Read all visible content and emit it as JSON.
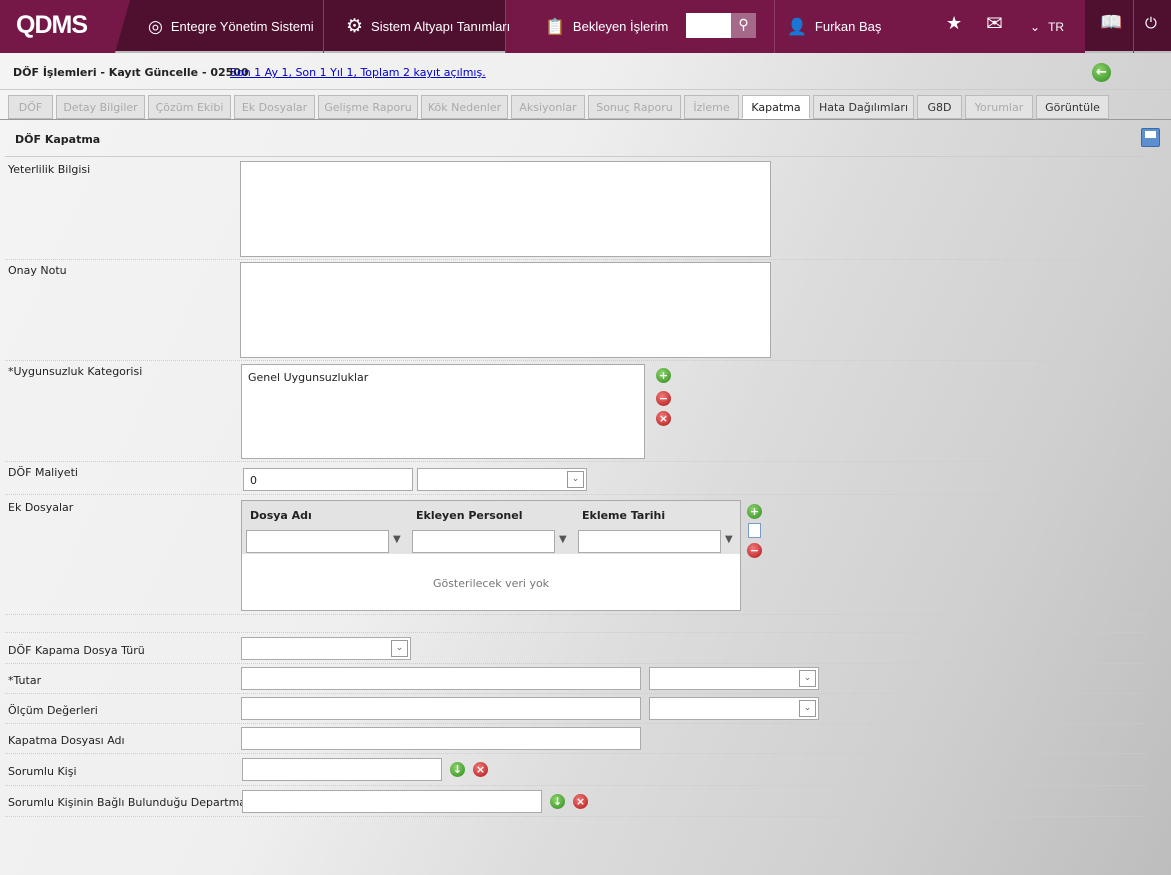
{
  "header": {
    "logo": "QDMS",
    "nav": [
      "Entegre Yönetim Sistemi",
      "Sistem Altyapı Tanımları",
      "Bekleyen İşlerim"
    ],
    "user": "Furkan Baş",
    "lang": "TR"
  },
  "breadcrumb": {
    "title": "DÖF İşlemleri - Kayıt Güncelle - 02500",
    "link": "Son 1 Ay 1, Son 1 Yıl 1, Toplam 2 kayıt açılmış."
  },
  "tabs": [
    {
      "label": "DÖF",
      "state": "disabled"
    },
    {
      "label": "Detay Bilgiler",
      "state": "disabled"
    },
    {
      "label": "Çözüm Ekibi",
      "state": "disabled"
    },
    {
      "label": "Ek Dosyalar",
      "state": "disabled"
    },
    {
      "label": "Gelişme Raporu",
      "state": "disabled"
    },
    {
      "label": "Kök Nedenler",
      "state": "disabled"
    },
    {
      "label": "Aksiyonlar",
      "state": "disabled"
    },
    {
      "label": "Sonuç Raporu",
      "state": "disabled"
    },
    {
      "label": "İzleme",
      "state": "disabled"
    },
    {
      "label": "Kapatma",
      "state": "active"
    },
    {
      "label": "Hata Dağılımları",
      "state": "enabled"
    },
    {
      "label": "G8D",
      "state": "enabled"
    },
    {
      "label": "Yorumlar",
      "state": "disabled"
    },
    {
      "label": "Görüntüle",
      "state": "enabled"
    }
  ],
  "section": {
    "title": "DÖF Kapatma"
  },
  "form": {
    "yeterlilik": "Yeterlilik Bilgisi",
    "onay": "Onay Notu",
    "kategori": "*Uygunsuzluk Kategorisi",
    "kategori_value": "Genel Uygunsuzluklar",
    "maliyet": "DÖF Maliyeti",
    "maliyet_value": "0",
    "ekdosyalar": "Ek Dosyalar",
    "dosyaturu": "DÖF Kapama Dosya Türü",
    "tutar": "*Tutar",
    "olcum": "Ölçüm Değerleri",
    "kapatmaadi": "Kapatma Dosyası Adı",
    "sorumlu": "Sorumlu Kişi",
    "departman": "Sorumlu Kişinin Bağlı Bulunduğu Departman"
  },
  "grid": {
    "columns": [
      "Dosya Adı",
      "Ekleyen Personel",
      "Ekleme Tarihi"
    ],
    "empty": "Gösterilecek veri yok"
  }
}
